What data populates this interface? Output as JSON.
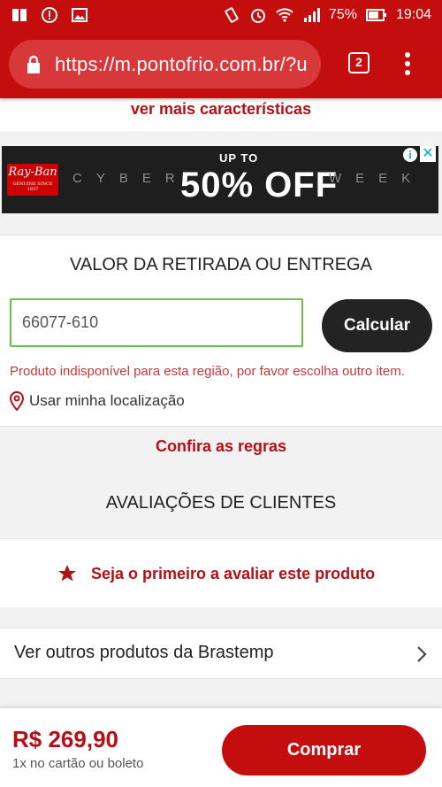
{
  "status_bar": {
    "left_icons": [
      "book-icon",
      "alert-circle-icon",
      "image-icon"
    ],
    "right_icons": [
      "vibrate-icon",
      "alarm-icon",
      "wifi-icon",
      "signal-icon",
      "battery-icon"
    ],
    "battery": "75%",
    "time": "19:04"
  },
  "browser": {
    "url": "https://m.pontofrio.com.br/?u",
    "tab_count": "2",
    "accent": "#c40e0e"
  },
  "product": {
    "more_features_link": "ver mais características"
  },
  "ad": {
    "brand": "Ray-Ban",
    "brand_tagline": "GENUINE SINCE 1937",
    "left_word": "CYBER",
    "up_to": "UP TO",
    "discount": "50% OFF",
    "right_word": "WEEK",
    "choice_glyph": "i",
    "close_glyph": "✕"
  },
  "shipping": {
    "title": "VALOR DA RETIRADA OU ENTREGA",
    "cep_value": "66077-610",
    "calc_button": "Calcular",
    "error_message": "Produto indisponível para esta região, por favor escolha outro item.",
    "use_location": "Usar minha localização",
    "rules_link": "Confira as regras"
  },
  "reviews": {
    "title": "AVALIAÇÕES DE CLIENTES",
    "first_review_link": "Seja o primeiro a avaliar este produto"
  },
  "other_products": {
    "label": "Ver outros produtos da Brastemp"
  },
  "buy_bar": {
    "price": "R$ 269,90",
    "installments": "1x no cartão ou boleto",
    "buy_button": "Comprar"
  }
}
